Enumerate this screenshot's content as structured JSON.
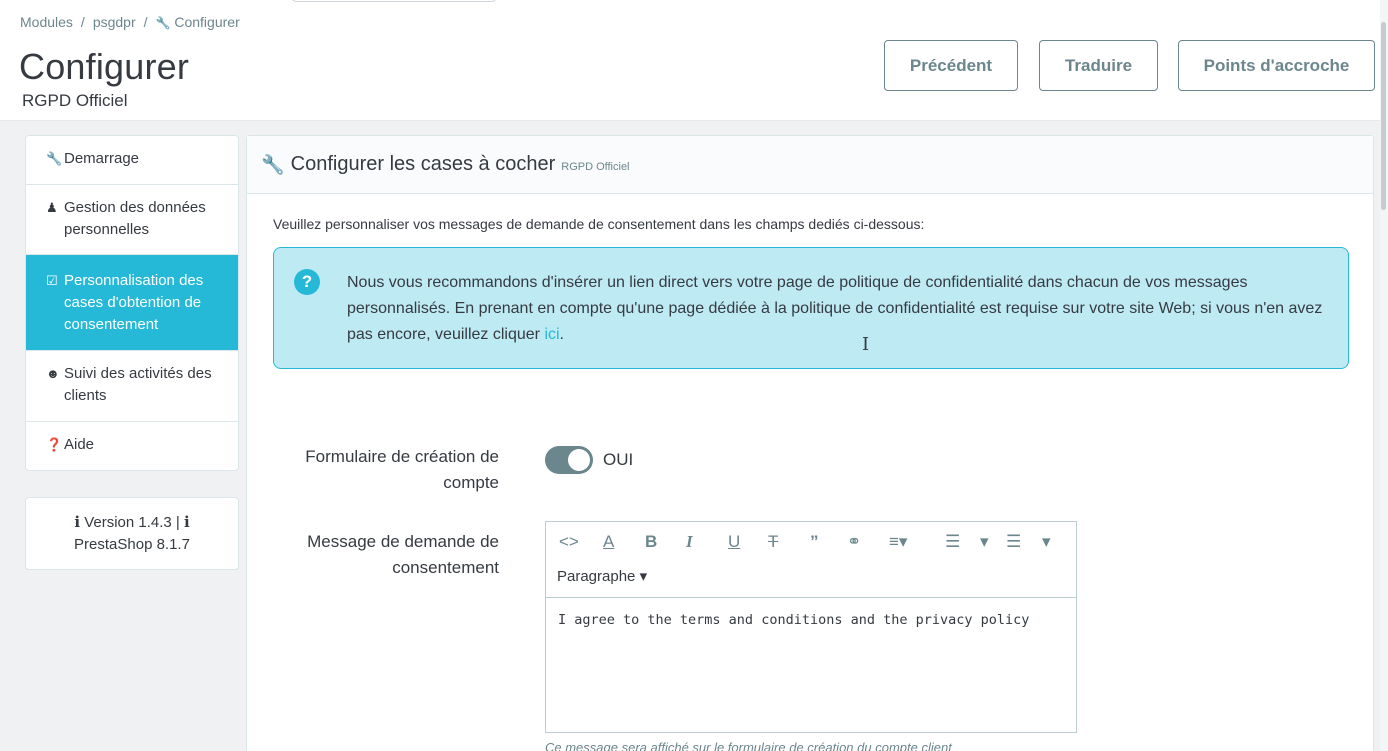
{
  "breadcrumb": {
    "items": [
      "Modules",
      "psgdpr",
      "Configurer"
    ],
    "separator": "/"
  },
  "header": {
    "title": "Configurer",
    "subtitle": "RGPD Officiel",
    "buttons": {
      "previous": "Précédent",
      "translate": "Traduire",
      "hooks": "Points d'accroche"
    }
  },
  "sidebar": {
    "items": [
      {
        "label": "Demarrage",
        "icon": "wrench-icon",
        "active": false
      },
      {
        "label": "Gestion des données personnelles",
        "icon": "user-secret-icon",
        "active": false
      },
      {
        "label": "Personnalisation des cases d'obtention de consentement",
        "icon": "checkbox-icon",
        "active": true
      },
      {
        "label": "Suivi des activités des clients",
        "icon": "user-circle-icon",
        "active": false
      },
      {
        "label": "Aide",
        "icon": "question-circle-icon",
        "active": false
      }
    ],
    "version": {
      "line1": "Version 1.4.3 |",
      "line2": "PrestaShop 8.1.7"
    }
  },
  "panel": {
    "title": "Configurer les cases à cocher",
    "title_small": "RGPD Officiel",
    "intro": "Veuillez personnaliser vos messages de demande de consentement dans les champs dediés ci-dessous:",
    "alert": {
      "text": "Nous vous recommandons d'insérer un lien direct vers votre page de politique de confidentialité dans chacun de vos messages personnalisés. En prenant en compte qu'une page dédiée à la politique de confidentialité est requise sur votre site Web; si vous n'en avez pas encore, veuillez cliquer ",
      "link": "ici",
      "after": "."
    }
  },
  "form": {
    "account_form_label": "Formulaire de création de compte",
    "switch_value": "OUI",
    "message_label": "Message de demande de consentement",
    "editor": {
      "paragraph_label": "Paragraphe",
      "content": "I agree to the terms and conditions and the privacy policy"
    },
    "hint": "Ce message sera affiché sur le formulaire de création du compte client"
  },
  "colors": {
    "accent": "#25b9d7",
    "alert_bg": "#beeaf3",
    "muted": "#6c868e",
    "text": "#363a41"
  }
}
